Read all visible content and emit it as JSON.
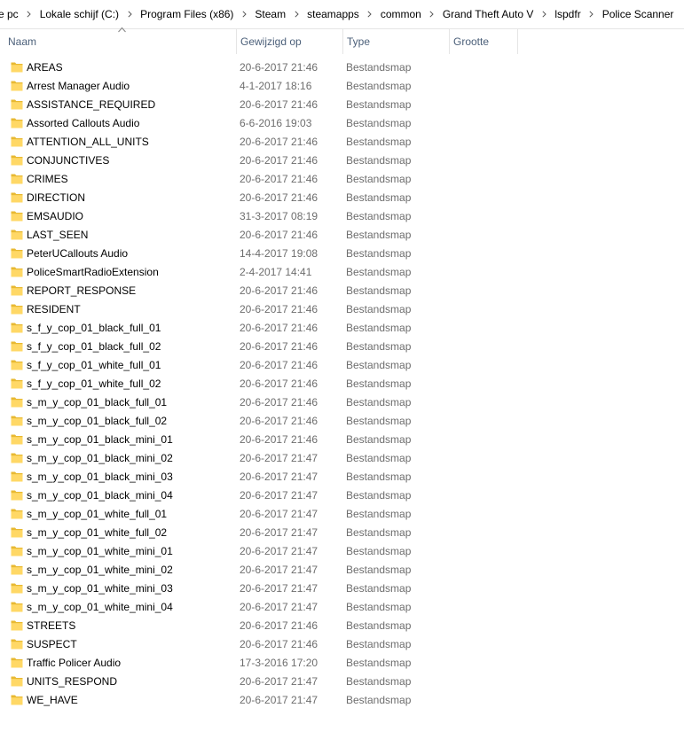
{
  "breadcrumb": [
    "e pc",
    "Lokale schijf (C:)",
    "Program Files (x86)",
    "Steam",
    "steamapps",
    "common",
    "Grand Theft Auto V",
    "lspdfr",
    "Police Scanner"
  ],
  "columns": {
    "name": "Naam",
    "modified": "Gewijzigd op",
    "type": "Type",
    "size": "Grootte"
  },
  "sort": {
    "column": "name",
    "direction": "ascending"
  },
  "colors": {
    "folder": "#ffd866",
    "folder_dark": "#e8b932",
    "header_text": "#4c607a",
    "secondary_text": "#6d6d6d"
  },
  "files": [
    {
      "name": "AREAS",
      "modified": "20-6-2017 21:46",
      "type": "Bestandsmap"
    },
    {
      "name": "Arrest Manager Audio",
      "modified": "4-1-2017 18:16",
      "type": "Bestandsmap"
    },
    {
      "name": "ASSISTANCE_REQUIRED",
      "modified": "20-6-2017 21:46",
      "type": "Bestandsmap"
    },
    {
      "name": "Assorted Callouts Audio",
      "modified": "6-6-2016 19:03",
      "type": "Bestandsmap"
    },
    {
      "name": "ATTENTION_ALL_UNITS",
      "modified": "20-6-2017 21:46",
      "type": "Bestandsmap"
    },
    {
      "name": "CONJUNCTIVES",
      "modified": "20-6-2017 21:46",
      "type": "Bestandsmap"
    },
    {
      "name": "CRIMES",
      "modified": "20-6-2017 21:46",
      "type": "Bestandsmap"
    },
    {
      "name": "DIRECTION",
      "modified": "20-6-2017 21:46",
      "type": "Bestandsmap"
    },
    {
      "name": "EMSAUDIO",
      "modified": "31-3-2017 08:19",
      "type": "Bestandsmap"
    },
    {
      "name": "LAST_SEEN",
      "modified": "20-6-2017 21:46",
      "type": "Bestandsmap"
    },
    {
      "name": "PeterUCallouts Audio",
      "modified": "14-4-2017 19:08",
      "type": "Bestandsmap"
    },
    {
      "name": "PoliceSmartRadioExtension",
      "modified": "2-4-2017 14:41",
      "type": "Bestandsmap"
    },
    {
      "name": "REPORT_RESPONSE",
      "modified": "20-6-2017 21:46",
      "type": "Bestandsmap"
    },
    {
      "name": "RESIDENT",
      "modified": "20-6-2017 21:46",
      "type": "Bestandsmap"
    },
    {
      "name": "s_f_y_cop_01_black_full_01",
      "modified": "20-6-2017 21:46",
      "type": "Bestandsmap"
    },
    {
      "name": "s_f_y_cop_01_black_full_02",
      "modified": "20-6-2017 21:46",
      "type": "Bestandsmap"
    },
    {
      "name": "s_f_y_cop_01_white_full_01",
      "modified": "20-6-2017 21:46",
      "type": "Bestandsmap"
    },
    {
      "name": "s_f_y_cop_01_white_full_02",
      "modified": "20-6-2017 21:46",
      "type": "Bestandsmap"
    },
    {
      "name": "s_m_y_cop_01_black_full_01",
      "modified": "20-6-2017 21:46",
      "type": "Bestandsmap"
    },
    {
      "name": "s_m_y_cop_01_black_full_02",
      "modified": "20-6-2017 21:46",
      "type": "Bestandsmap"
    },
    {
      "name": "s_m_y_cop_01_black_mini_01",
      "modified": "20-6-2017 21:46",
      "type": "Bestandsmap"
    },
    {
      "name": "s_m_y_cop_01_black_mini_02",
      "modified": "20-6-2017 21:47",
      "type": "Bestandsmap"
    },
    {
      "name": "s_m_y_cop_01_black_mini_03",
      "modified": "20-6-2017 21:47",
      "type": "Bestandsmap"
    },
    {
      "name": "s_m_y_cop_01_black_mini_04",
      "modified": "20-6-2017 21:47",
      "type": "Bestandsmap"
    },
    {
      "name": "s_m_y_cop_01_white_full_01",
      "modified": "20-6-2017 21:47",
      "type": "Bestandsmap"
    },
    {
      "name": "s_m_y_cop_01_white_full_02",
      "modified": "20-6-2017 21:47",
      "type": "Bestandsmap"
    },
    {
      "name": "s_m_y_cop_01_white_mini_01",
      "modified": "20-6-2017 21:47",
      "type": "Bestandsmap"
    },
    {
      "name": "s_m_y_cop_01_white_mini_02",
      "modified": "20-6-2017 21:47",
      "type": "Bestandsmap"
    },
    {
      "name": "s_m_y_cop_01_white_mini_03",
      "modified": "20-6-2017 21:47",
      "type": "Bestandsmap"
    },
    {
      "name": "s_m_y_cop_01_white_mini_04",
      "modified": "20-6-2017 21:47",
      "type": "Bestandsmap"
    },
    {
      "name": "STREETS",
      "modified": "20-6-2017 21:46",
      "type": "Bestandsmap"
    },
    {
      "name": "SUSPECT",
      "modified": "20-6-2017 21:46",
      "type": "Bestandsmap"
    },
    {
      "name": "Traffic Policer Audio",
      "modified": "17-3-2016 17:20",
      "type": "Bestandsmap"
    },
    {
      "name": "UNITS_RESPOND",
      "modified": "20-6-2017 21:47",
      "type": "Bestandsmap"
    },
    {
      "name": "WE_HAVE",
      "modified": "20-6-2017 21:47",
      "type": "Bestandsmap"
    }
  ]
}
